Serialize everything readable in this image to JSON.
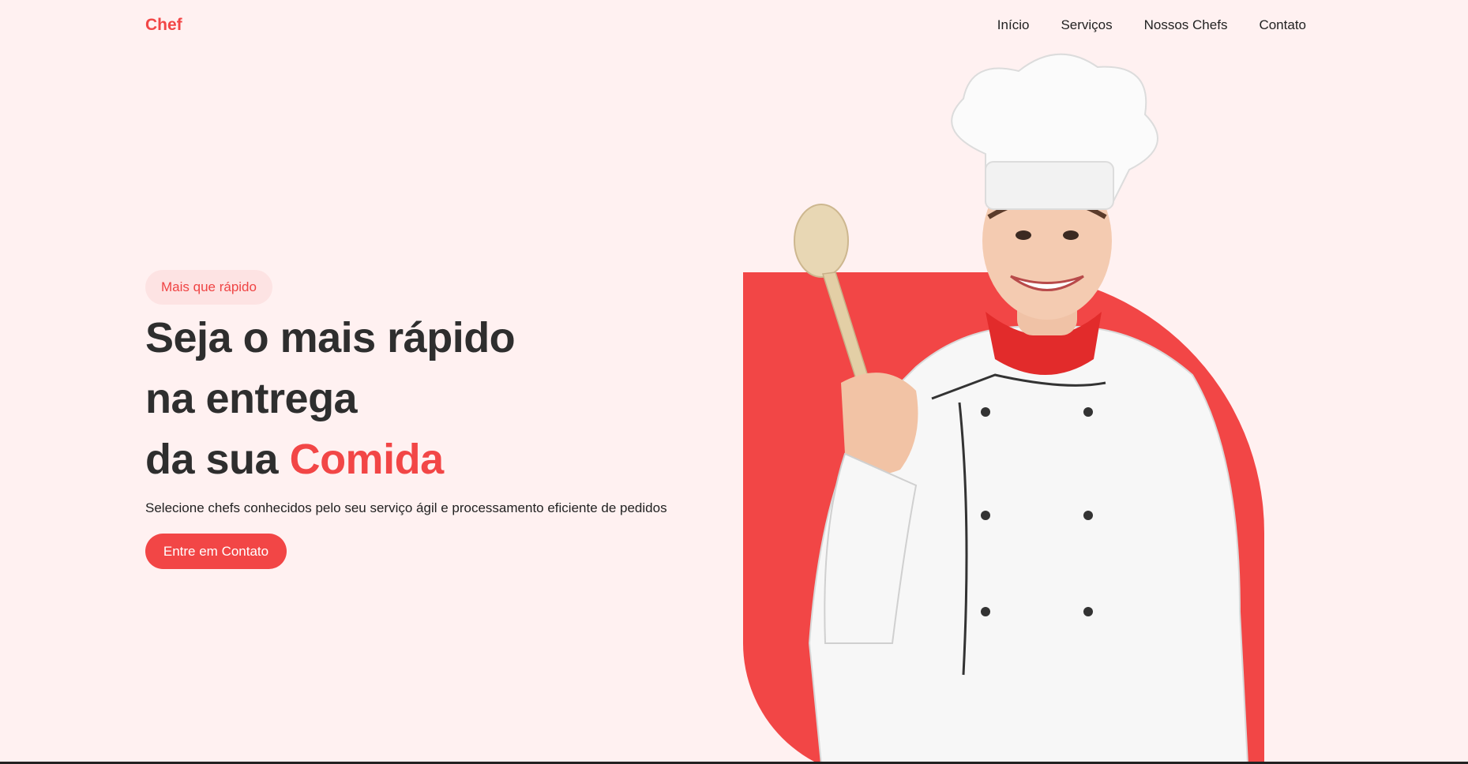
{
  "brand": {
    "name": "Chef",
    "accent_color": "#f24646"
  },
  "nav": {
    "items": [
      {
        "label": "Início"
      },
      {
        "label": "Serviços"
      },
      {
        "label": "Nossos Chefs"
      },
      {
        "label": "Contato"
      }
    ]
  },
  "hero": {
    "badge": "Mais que rápido",
    "headline_line1": "Seja o mais rápido",
    "headline_line2": "na entrega",
    "headline_line3_prefix": "da sua ",
    "headline_line3_accent": "Comida",
    "subtitle": "Selecione chefs conhecidos pelo seu serviço ágil e processamento eficiente de pedidos",
    "cta_label": "Entre em Contato"
  },
  "colors": {
    "background": "#fff1f1",
    "accent": "#f24646",
    "badge_background": "#fde3e3",
    "text_dark": "#2e2e2e"
  }
}
